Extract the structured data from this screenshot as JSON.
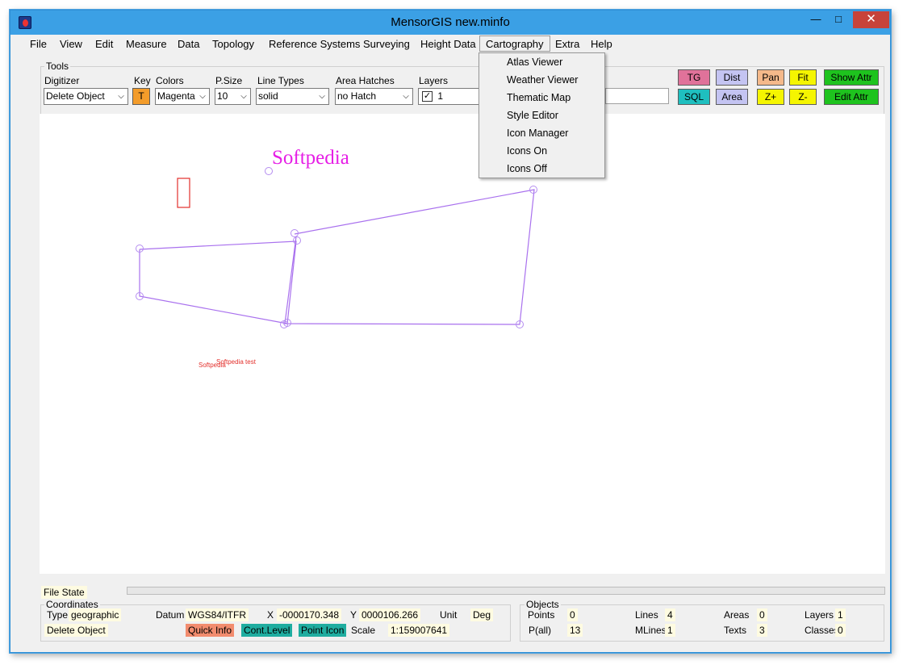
{
  "window": {
    "title": "MensorGIS new.minfo"
  },
  "menu": [
    "File",
    "View",
    "Edit",
    "Measure",
    "Data",
    "Topology",
    "Reference Systems",
    "Surveying",
    "Height Data",
    "Cartography",
    "Extra",
    "Help"
  ],
  "cartography_menu": [
    "Atlas Viewer",
    "Weather Viewer",
    "Thematic Map",
    "Style Editor",
    "Icon Manager",
    "Icons On",
    "Icons Off"
  ],
  "tools": {
    "caption": "Tools",
    "digitizer_label": "Digitizer",
    "digitizer_value": "Delete Object",
    "key_label": "Key",
    "key_button": "T",
    "colors_label": "Colors",
    "colors_value": "Magenta",
    "psize_label": "P.Size",
    "psize_value": "10",
    "linetypes_label": "Line Types",
    "linetypes_value": "solid",
    "hatches_label": "Area Hatches",
    "hatches_value": "no Hatch",
    "layers_label": "Layers",
    "layers_value": "1",
    "buttons": {
      "tg": "TG",
      "sql": "SQL",
      "dist": "Dist",
      "area": "Area",
      "pan": "Pan",
      "zin": "Z+",
      "fit": "Fit",
      "zout": "Z-",
      "show_attr": "Show Attr",
      "edit_attr": "Edit Attr"
    }
  },
  "canvas": {
    "title_text": "Softpedia",
    "label1": "Softpedia",
    "label2": "Softpedia test"
  },
  "status": {
    "file_state": "File State"
  },
  "coordinates": {
    "caption": "Coordinates",
    "type_label": "Type",
    "type_value": "geographic",
    "datum_label": "Datum",
    "datum_value": "WGS84/ITFR",
    "x_label": "X",
    "x_value": "-0000170.348",
    "y_label": "Y",
    "y_value": "0000106.266",
    "unit_label": "Unit",
    "unit_value": "Deg",
    "mode_value": "Delete Object",
    "quick_info": "Quick Info",
    "cont_level": "Cont.Level",
    "point_icon": "Point Icon",
    "scale_label": "Scale",
    "scale_value": "1:159007641"
  },
  "objects": {
    "caption": "Objects",
    "points_label": "Points",
    "points_value": "0",
    "pall_label": "P(all)",
    "pall_value": "13",
    "lines_label": "Lines",
    "lines_value": "4",
    "mlines_label": "MLines",
    "mlines_value": "1",
    "areas_label": "Areas",
    "areas_value": "0",
    "texts_label": "Texts",
    "texts_value": "3",
    "layers_label": "Layers",
    "layers_value": "1",
    "classes_label": "Classes",
    "classes_value": "0"
  },
  "colors": {
    "titlebar": "#3ba0e5",
    "close": "#c7433a",
    "key": "#f39c2a",
    "tg": "#e0729a",
    "sql": "#1fbfbf",
    "dist": "#c4c4f2",
    "pan": "#f5b98a",
    "yellow": "#f5f500",
    "green": "#1ec31e",
    "quick_info": "#f28c6e",
    "teal": "#1fada0",
    "magenta": "#e61ee6",
    "purple": "#a971ee",
    "red": "#e3302c"
  }
}
